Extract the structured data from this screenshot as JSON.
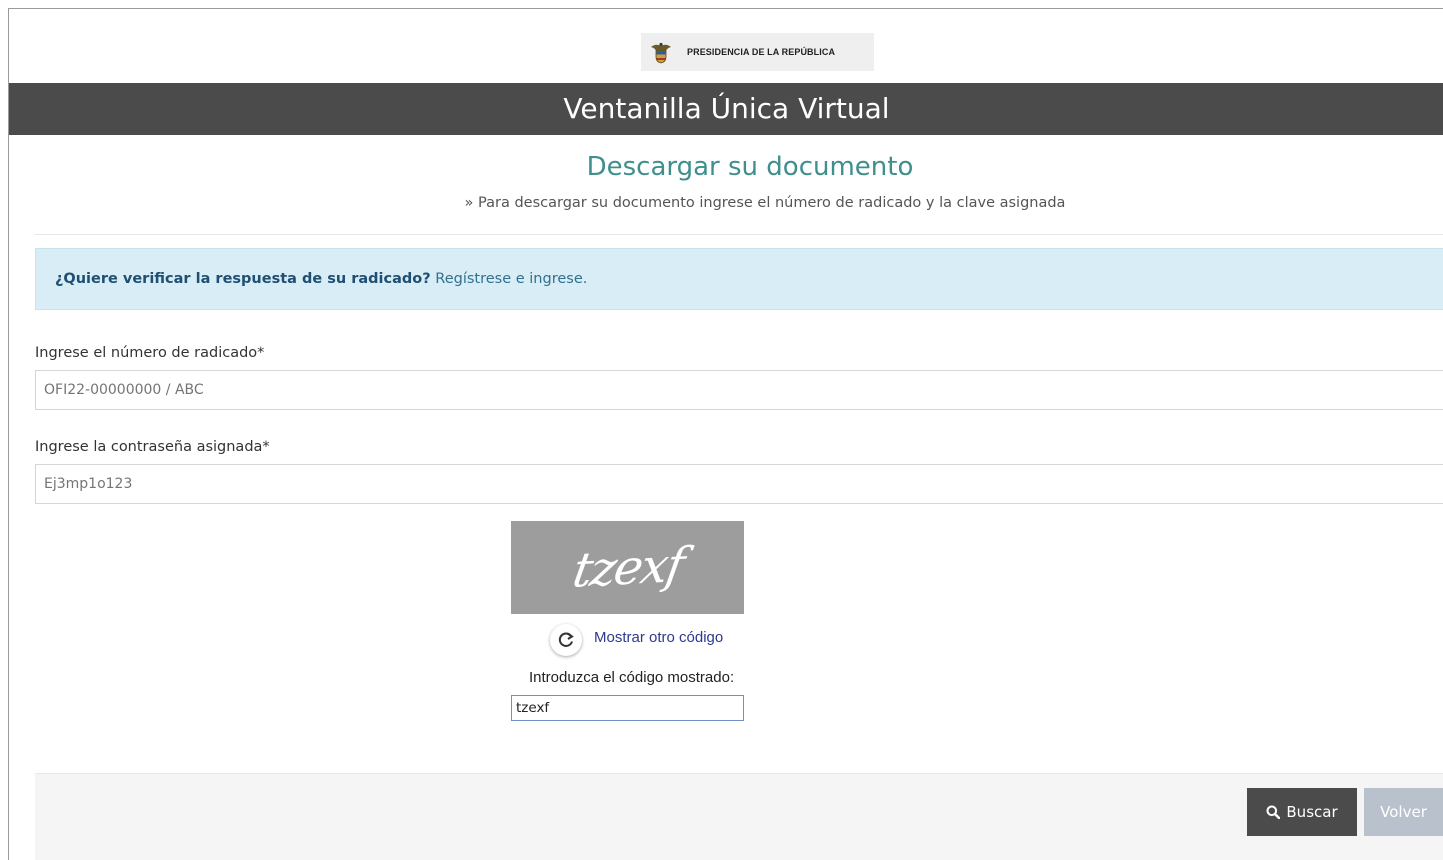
{
  "header": {
    "logo_text": "PRESIDENCIA DE LA REPÚBLICA",
    "banner_title": "Ventanilla Única Virtual"
  },
  "main": {
    "title": "Descargar su documento",
    "subtitle": "» Para descargar su documento ingrese el número de radicado y la clave asignada"
  },
  "alert": {
    "question": "¿Quiere verificar la respuesta de su radicado?",
    "link": "Regístrese e ingrese."
  },
  "form": {
    "radicado_label": "Ingrese el número de radicado*",
    "radicado_placeholder": "OFI22-00000000 / ABC",
    "password_label": "Ingrese la contraseña asignada*",
    "password_placeholder": "Ej3mp1o123"
  },
  "captcha": {
    "image_text": "tzexf",
    "refresh_label": "Mostrar otro código",
    "prompt": "Introduzca el código mostrado:",
    "input_value": "tzexf"
  },
  "footer": {
    "buscar_label": "Buscar",
    "volver_label": "Volver"
  },
  "icons": {
    "seal": "colombia-coat-of-arms-icon",
    "refresh": "refresh-icon",
    "search": "search-icon"
  },
  "colors": {
    "banner": "#4b4b4b",
    "title": "#3f8f8c",
    "alert_bg": "#d9edf7",
    "buscar_bg": "#4b4b4b",
    "volver_bg": "#b9c2cc"
  }
}
